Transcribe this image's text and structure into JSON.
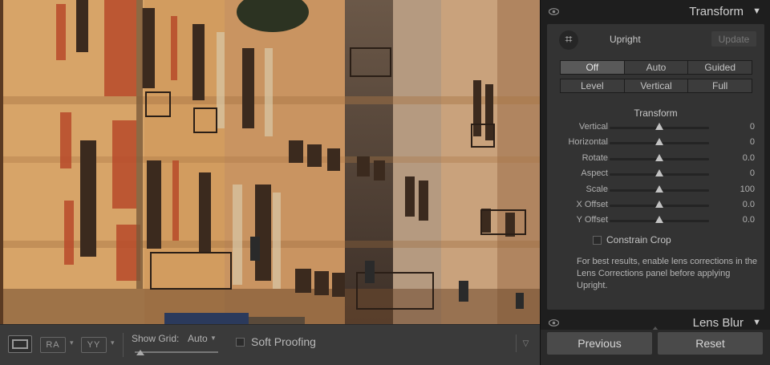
{
  "toolbar": {
    "view_ra_label": "RA",
    "view_yy_label": "YY",
    "show_grid_label": "Show Grid:",
    "show_grid_value": "Auto",
    "soft_proofing_label": "Soft Proofing",
    "soft_proofing_checked": false
  },
  "panel": {
    "title": "Transform",
    "upright_label": "Upright",
    "update_label": "Update",
    "upright_modes_row1": [
      "Off",
      "Auto",
      "Guided"
    ],
    "upright_modes_row2": [
      "Level",
      "Vertical",
      "Full"
    ],
    "selected_mode": "Off",
    "transform_subheading": "Transform",
    "sliders": [
      {
        "label": "Vertical",
        "value": "0",
        "position": 0.5
      },
      {
        "label": "Horizontal",
        "value": "0",
        "position": 0.5
      },
      {
        "label": "Rotate",
        "value": "0.0",
        "position": 0.5
      },
      {
        "label": "Aspect",
        "value": "0",
        "position": 0.5
      },
      {
        "label": "Scale",
        "value": "100",
        "position": 0.5
      },
      {
        "label": "X Offset",
        "value": "0.0",
        "position": 0.5
      },
      {
        "label": "Y Offset",
        "value": "0.0",
        "position": 0.5
      }
    ],
    "constrain_crop_label": "Constrain Crop",
    "constrain_crop_checked": false,
    "hint_text": "For best results, enable lens corrections in the Lens Corrections panel before applying Upright.",
    "next_panel_title": "Lens Blur",
    "previous_label": "Previous",
    "reset_label": "Reset"
  },
  "colors": {
    "panel_bg": "#333333",
    "active_segment": "#595959",
    "button_bg": "#4a4a4a"
  }
}
